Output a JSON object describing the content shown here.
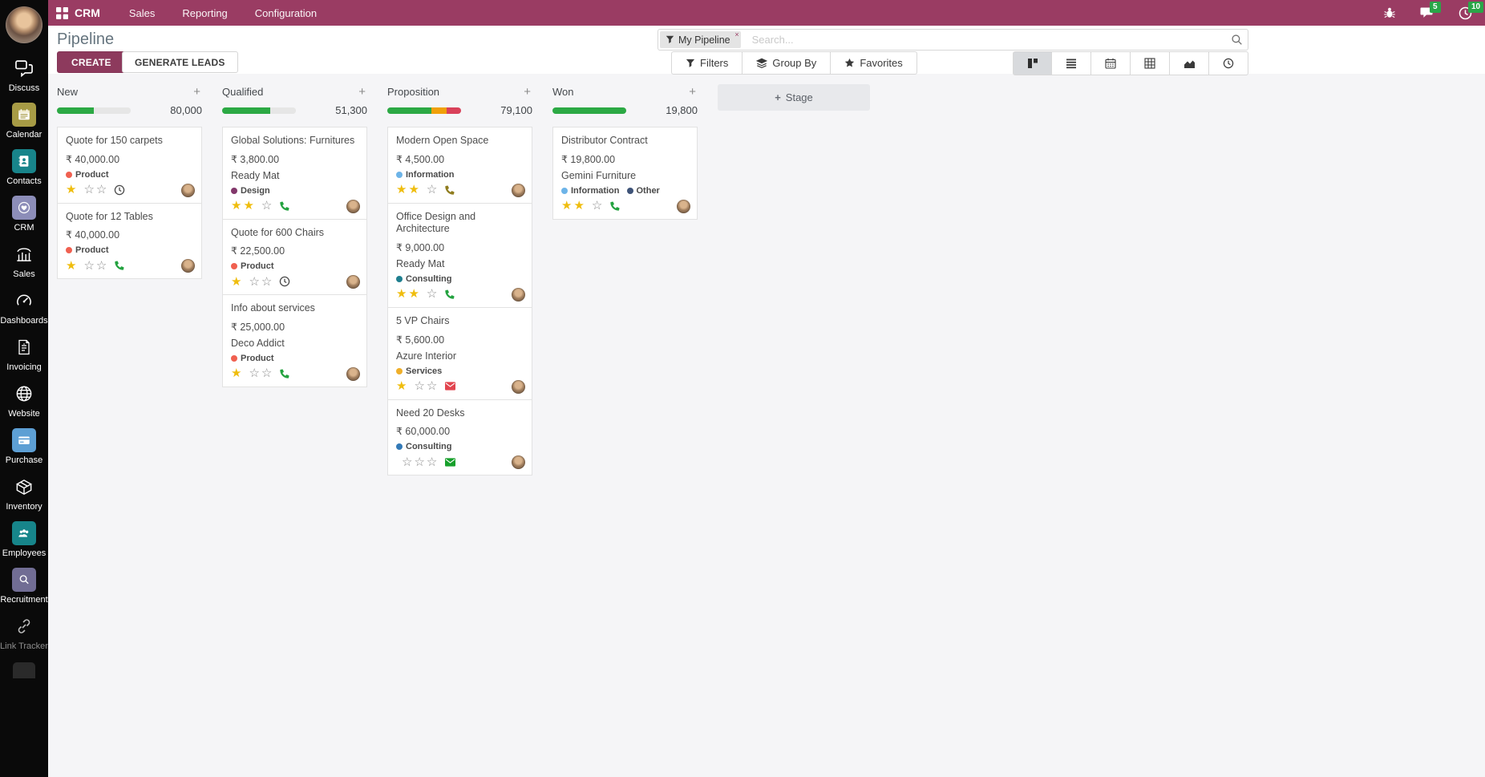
{
  "colors": {
    "brand": "#9a3c63",
    "create_button": "#8d3a5d",
    "badge_green": "#2aa648",
    "progress_green": "#2ca944",
    "progress_orange": "#f0a009",
    "progress_red": "#d9415a",
    "progress_empty": "#e6e6e6",
    "star_gold": "#efbd0e",
    "kanban_active_bg": "#d8dadd",
    "stage_button_bg": "#e8e9ec"
  },
  "ui": {
    "plus": "+"
  },
  "topbar": {
    "app_name": "CRM",
    "menus": [
      "Sales",
      "Reporting",
      "Configuration"
    ],
    "message_badge": "5",
    "activity_badge": "10"
  },
  "sidebar": {
    "items": [
      {
        "label": "Discuss"
      },
      {
        "label": "Calendar"
      },
      {
        "label": "Contacts"
      },
      {
        "label": "CRM"
      },
      {
        "label": "Sales"
      },
      {
        "label": "Dashboards"
      },
      {
        "label": "Invoicing"
      },
      {
        "label": "Website"
      },
      {
        "label": "Purchase"
      },
      {
        "label": "Inventory"
      },
      {
        "label": "Employees"
      },
      {
        "label": "Recruitment"
      },
      {
        "label": "Link Tracker"
      }
    ]
  },
  "control_panel": {
    "title": "Pipeline",
    "create_label": "CREATE",
    "generate_leads_label": "GENERATE LEADS",
    "search": {
      "facet": "My Pipeline",
      "remove": "×",
      "placeholder": "Search..."
    },
    "filters_label": "Filters",
    "group_by_label": "Group By",
    "favorites_label": "Favorites"
  },
  "kanban": {
    "add_stage_label": "Stage",
    "columns": [
      {
        "name": "New",
        "amount": "80,000",
        "progress": [
          {
            "color": "#2ca944",
            "width": "50%"
          },
          {
            "color": "#e6e6e6",
            "width": "50%"
          }
        ],
        "cards": [
          {
            "title": "Quote for 150 carpets",
            "amount": "₹ 40,000.00",
            "tags": [
              {
                "label": "Product",
                "color": "#f06050"
              }
            ],
            "stars_filled": "★",
            "stars_empty": "☆☆",
            "activity_icon": "clock-icon",
            "activity_color": "#4a4a4a"
          },
          {
            "title": "Quote for 12 Tables",
            "amount": "₹ 40,000.00",
            "tags": [
              {
                "label": "Product",
                "color": "#f06050"
              }
            ],
            "stars_filled": "★",
            "stars_empty": "☆☆",
            "activity_icon": "phone-icon",
            "activity_color": "#23a23f"
          }
        ]
      },
      {
        "name": "Qualified",
        "amount": "51,300",
        "progress": [
          {
            "color": "#2ca944",
            "width": "65%"
          },
          {
            "color": "#e6e6e6",
            "width": "35%"
          }
        ],
        "cards": [
          {
            "title": "Global Solutions: Furnitures",
            "amount": "₹ 3,800.00",
            "partner": "Ready Mat",
            "tags": [
              {
                "label": "Design",
                "color": "#82386b"
              }
            ],
            "stars_filled": "★★",
            "stars_empty": "☆",
            "activity_icon": "phone-icon",
            "activity_color": "#23a23f"
          },
          {
            "title": "Quote for 600 Chairs",
            "amount": "₹ 22,500.00",
            "tags": [
              {
                "label": "Product",
                "color": "#f06050"
              }
            ],
            "stars_filled": "★",
            "stars_empty": "☆☆",
            "activity_icon": "clock-icon",
            "activity_color": "#4a4a4a"
          },
          {
            "title": "Info about services",
            "amount": "₹ 25,000.00",
            "partner": "Deco Addict",
            "tags": [
              {
                "label": "Product",
                "color": "#f06050"
              }
            ],
            "stars_filled": "★",
            "stars_empty": "☆☆",
            "activity_icon": "phone-icon",
            "activity_color": "#23a23f"
          }
        ]
      },
      {
        "name": "Proposition",
        "amount": "79,100",
        "progress": [
          {
            "color": "#2ca944",
            "width": "60%"
          },
          {
            "color": "#f0a009",
            "width": "20%"
          },
          {
            "color": "#d9415a",
            "width": "20%"
          }
        ],
        "cards": [
          {
            "title": "Modern Open Space",
            "amount": "₹ 4,500.00",
            "tags": [
              {
                "label": "Information",
                "color": "#6db4e8"
              }
            ],
            "stars_filled": "★★",
            "stars_empty": "☆",
            "activity_icon": "phone-icon",
            "activity_color": "#8f7c1e"
          },
          {
            "title": "Office Design and Architecture",
            "amount": "₹ 9,000.00",
            "partner": "Ready Mat",
            "tags": [
              {
                "label": "Consulting",
                "color": "#1f7f8f"
              }
            ],
            "stars_filled": "★★",
            "stars_empty": "☆",
            "activity_icon": "phone-icon",
            "activity_color": "#23a23f"
          },
          {
            "title": "5 VP Chairs",
            "amount": "₹ 5,600.00",
            "partner": "Azure Interior",
            "tags": [
              {
                "label": "Services",
                "color": "#efaf2a"
              }
            ],
            "stars_filled": "★",
            "stars_empty": "☆☆",
            "activity_icon": "envelope-icon",
            "activity_color": "#e2444e"
          },
          {
            "title": "Need 20 Desks",
            "amount": "₹ 60,000.00",
            "tags": [
              {
                "label": "Consulting",
                "color": "#337ab7"
              }
            ],
            "stars_filled": "",
            "stars_empty": "☆☆☆",
            "activity_icon": "envelope-icon",
            "activity_color": "#17a02b"
          }
        ]
      },
      {
        "name": "Won",
        "amount": "19,800",
        "progress": [
          {
            "color": "#2ca944",
            "width": "100%"
          }
        ],
        "cards": [
          {
            "title": "Distributor Contract",
            "amount": "₹ 19,800.00",
            "partner": "Gemini Furniture",
            "tags": [
              {
                "label": "Information",
                "color": "#6db4e8"
              },
              {
                "label": "Other",
                "color": "#3e5378"
              }
            ],
            "stars_filled": "★★",
            "stars_empty": "☆",
            "activity_icon": "phone-icon",
            "activity_color": "#23a23f"
          }
        ]
      }
    ]
  }
}
